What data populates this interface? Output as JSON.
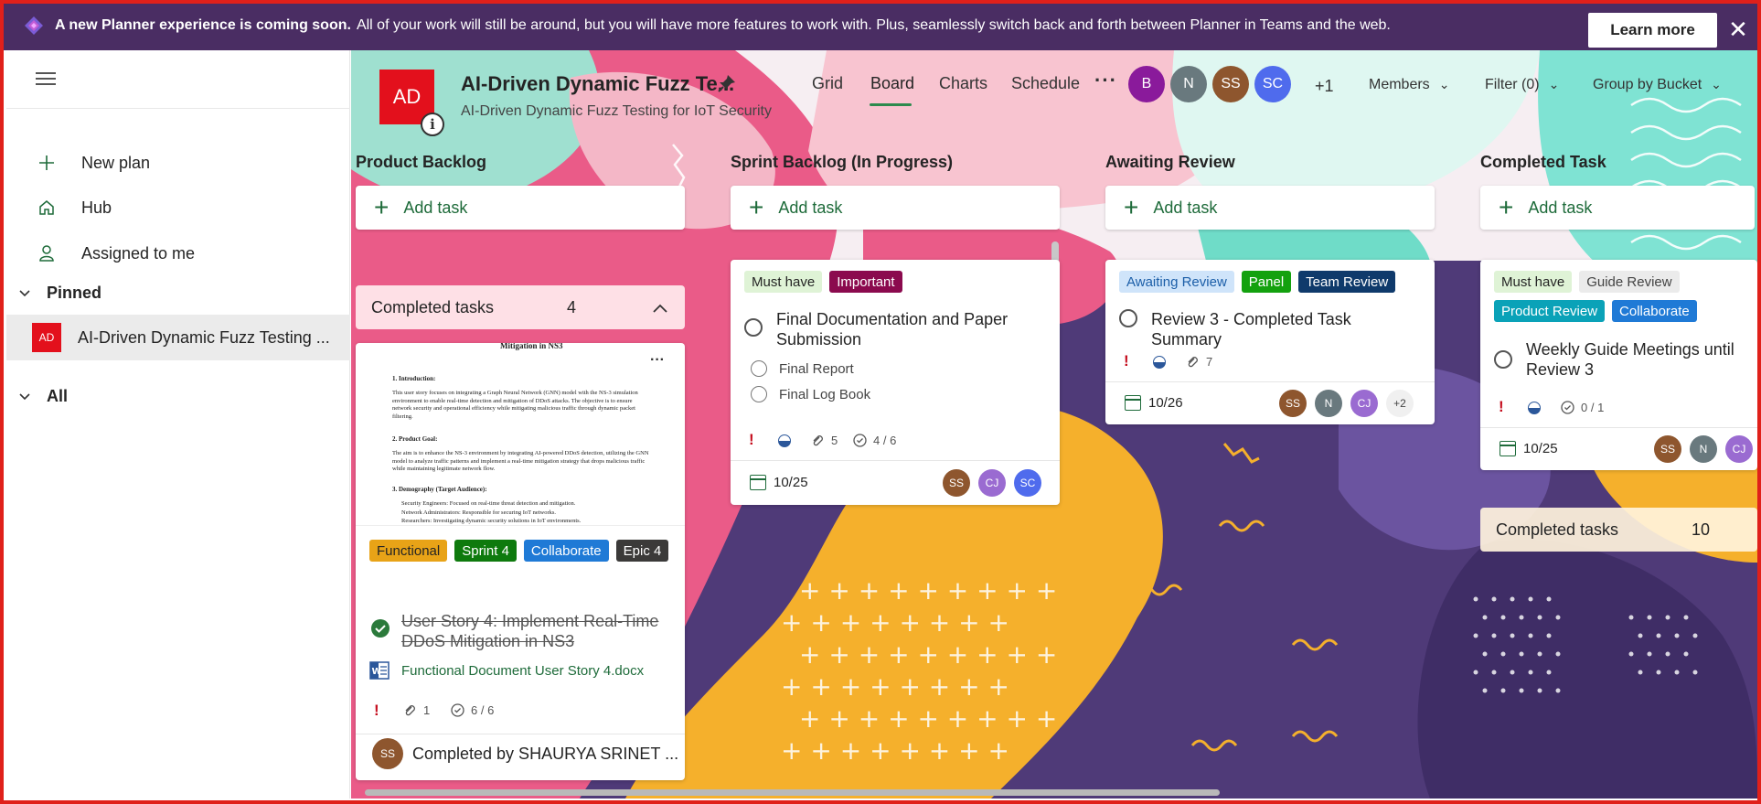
{
  "banner": {
    "bold": "A new Planner experience is coming soon.",
    "text": "All of your work will still be around, but you will have more features to work with. Plus, seamlessly switch back and forth between Planner in Teams and the web.",
    "learn_more": "Learn more",
    "close": "✕"
  },
  "sidebar": {
    "new_plan": "New plan",
    "hub": "Hub",
    "assigned": "Assigned to me",
    "pinned_label": "Pinned",
    "pinned_plan_initials": "AD",
    "pinned_plan_name": "AI-Driven Dynamic Fuzz Testing ...",
    "all_label": "All"
  },
  "header": {
    "plan_initials": "AD",
    "info": "i",
    "title": "AI-Driven Dynamic Fuzz Te...",
    "subtitle": "AI-Driven Dynamic Fuzz Testing for IoT Security",
    "tabs": {
      "grid": "Grid",
      "board": "Board",
      "charts": "Charts",
      "schedule": "Schedule"
    },
    "more": "···",
    "members": [
      {
        "initials": "B",
        "color": "#8a1a9b"
      },
      {
        "initials": "N",
        "color": "#69797e"
      },
      {
        "initials": "SS",
        "color": "#8e562e"
      },
      {
        "initials": "SC",
        "color": "#4f6bed"
      }
    ],
    "extra_members": "+1",
    "members_label": "Members",
    "filter_label": "Filter (0)",
    "group_label": "Group by Bucket"
  },
  "columns": [
    {
      "title": "Product Backlog",
      "add_task": "Add task"
    },
    {
      "title": "Sprint Backlog (In Progress)",
      "add_task": "Add task"
    },
    {
      "title": "Awaiting Review",
      "add_task": "Add task"
    },
    {
      "title": "Completed Task",
      "add_task": "Add task"
    }
  ],
  "col1": {
    "completed_label": "Completed tasks",
    "completed_count": "4",
    "preview": {
      "heading": "Mitigation in NS3",
      "h1": "1. Introduction:",
      "p1": "This user story focuses on integrating a Graph Neural Network (GNN) model with the NS-3 simulation environment to enable real-time detection and mitigation of DDoS attacks. The objective is to ensure network security and operational efficiency while mitigating malicious traffic through dynamic packet filtering.",
      "h2": "2. Product Goal:",
      "p2": "The aim is to enhance the NS-3 environment by integrating AI-powered DDoS detection, utilizing the GNN model to analyze traffic patterns and implement a real-time mitigation strategy that drops malicious traffic while maintaining legitimate network flow.",
      "h3": "3. Demography (Target Audience):",
      "b1": "Security Engineers: Focused on real-time threat detection and mitigation.",
      "b2": "Network Administrators: Responsible for securing IoT networks.",
      "b3": "Researchers: Investigating dynamic security solutions in IoT environments."
    },
    "labels": [
      {
        "text": "Functional",
        "bg": "#e8a317",
        "fg": "#242424"
      },
      {
        "text": "Sprint 4",
        "bg": "#0e7a0d",
        "fg": "#ffffff"
      },
      {
        "text": "Collaborate",
        "bg": "#1f7ad6",
        "fg": "#ffffff"
      },
      {
        "text": "Epic 4",
        "bg": "#3b3a39",
        "fg": "#ffffff"
      }
    ],
    "title": "User Story 4: Implement Real-Time DDoS Mitigation in NS3",
    "attachment": "Functional Document User Story 4.docx",
    "attachments": "1",
    "checklist": "6 / 6",
    "completed_by_initials": "SS",
    "completed_by": "Completed by SHAURYA SRINET ..."
  },
  "col2": {
    "labels": [
      {
        "text": "Must have",
        "bg": "#dff3d6",
        "fg": "#242424"
      },
      {
        "text": "Important",
        "bg": "#8b0a4e",
        "fg": "#ffffff"
      }
    ],
    "title": "Final Documentation and Paper Submission",
    "checklist_items": [
      "Final Report",
      "Final Log Book"
    ],
    "attachments": "5",
    "checklist": "4 / 6",
    "date": "10/25",
    "assignees": [
      {
        "initials": "SS",
        "color": "#8e562e"
      },
      {
        "initials": "CJ",
        "color": "#9a6bd1"
      },
      {
        "initials": "SC",
        "color": "#4f6bed"
      }
    ]
  },
  "col3": {
    "labels": [
      {
        "text": "Awaiting Review",
        "bg": "#cfe4fa",
        "fg": "#1b5ea8"
      },
      {
        "text": "Panel",
        "bg": "#13a10e",
        "fg": "#ffffff"
      },
      {
        "text": "Team Review",
        "bg": "#0f3a6b",
        "fg": "#ffffff"
      }
    ],
    "title": "Review 3 - Completed Task Summary",
    "attachments": "7",
    "date": "10/26",
    "assignees": [
      {
        "initials": "SS",
        "color": "#8e562e"
      },
      {
        "initials": "N",
        "color": "#69797e"
      },
      {
        "initials": "CJ",
        "color": "#9a6bd1"
      }
    ],
    "more_assignees": "+2"
  },
  "col4": {
    "labels": [
      {
        "text": "Must have",
        "bg": "#dff3d6",
        "fg": "#242424"
      },
      {
        "text": "Guide Review",
        "bg": "#ebebeb",
        "fg": "#444444"
      },
      {
        "text": "Product Review",
        "bg": "#0aa2b8",
        "fg": "#ffffff"
      },
      {
        "text": "Collaborate",
        "bg": "#1f7ad6",
        "fg": "#ffffff"
      }
    ],
    "title": "Weekly Guide Meetings until Review 3",
    "checklist": "0 / 1",
    "date": "10/25",
    "assignees": [
      {
        "initials": "SS",
        "color": "#8e562e"
      },
      {
        "initials": "N",
        "color": "#69797e"
      },
      {
        "initials": "CJ",
        "color": "#9a6bd1"
      }
    ],
    "completed_label": "Completed tasks",
    "completed_count": "10"
  }
}
